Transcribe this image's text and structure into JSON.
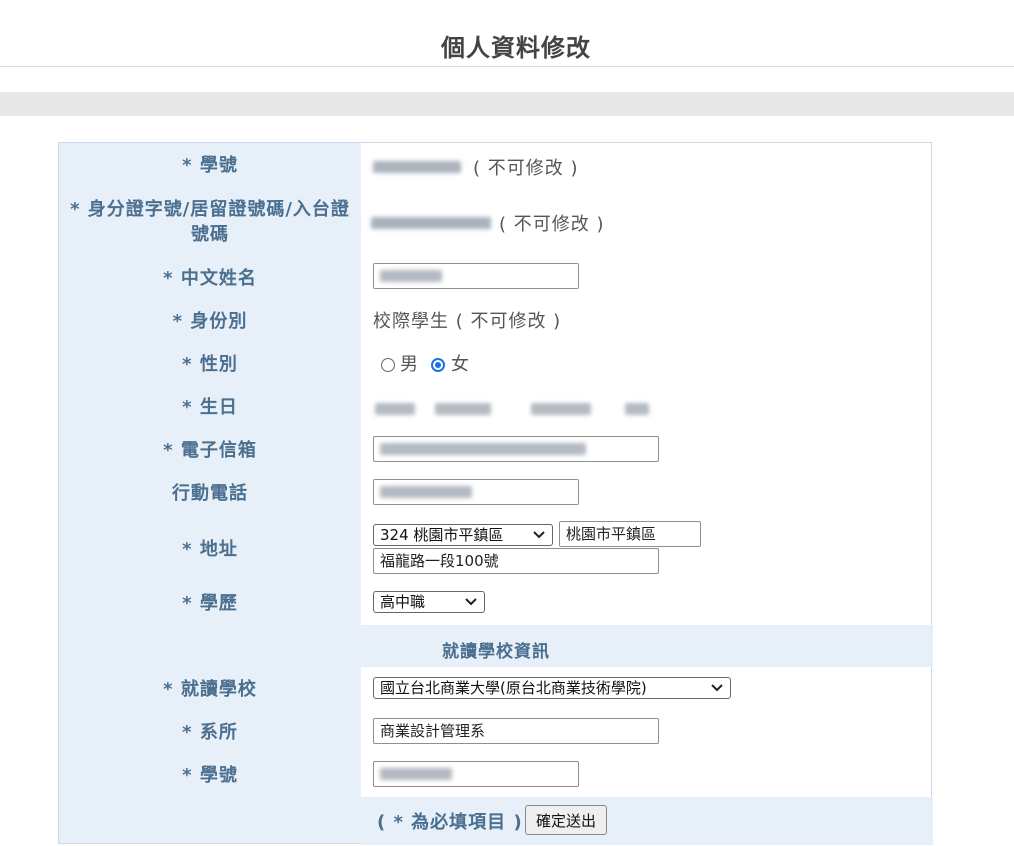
{
  "page": {
    "title": "個人資料修改"
  },
  "fields": {
    "student_id": {
      "label": "* 學號",
      "note": "( 不可修改 )"
    },
    "id_number": {
      "label_line1": "* 身分證字號/居留證號碼/入台證",
      "label_line2": "號碼",
      "note": "( 不可修改 )"
    },
    "chinese_name": {
      "label": "* 中文姓名"
    },
    "identity": {
      "label": "* 身份別",
      "value": "校際學生 ( 不可修改 )"
    },
    "gender": {
      "label": "* 性別",
      "options": [
        "男",
        "女"
      ],
      "selected": "女"
    },
    "birthday": {
      "label": "* 生日"
    },
    "email": {
      "label": "* 電子信箱"
    },
    "mobile": {
      "label": "行動電話"
    },
    "address": {
      "label": "* 地址",
      "zip_select": "324 桃園市平鎮區",
      "district": "桃園市平鎮區",
      "street": "福龍路一段100號"
    },
    "education": {
      "label": "* 學歷",
      "value": "高中職"
    }
  },
  "school_section": {
    "title": "就讀學校資訊",
    "school": {
      "label": "* 就讀學校",
      "value": "國立台北商業大學(原台北商業技術學院)"
    },
    "department": {
      "label": "* 系所",
      "value": "商業設計管理系"
    },
    "student_no": {
      "label": "* 學號"
    }
  },
  "footer": {
    "required_note": "( * 為必填項目 )",
    "submit_label": "確定送出"
  },
  "colors": {
    "label_text": "#4b6f8f",
    "label_bg": "#e7eff8",
    "radio_selected": "#1a73e8"
  }
}
